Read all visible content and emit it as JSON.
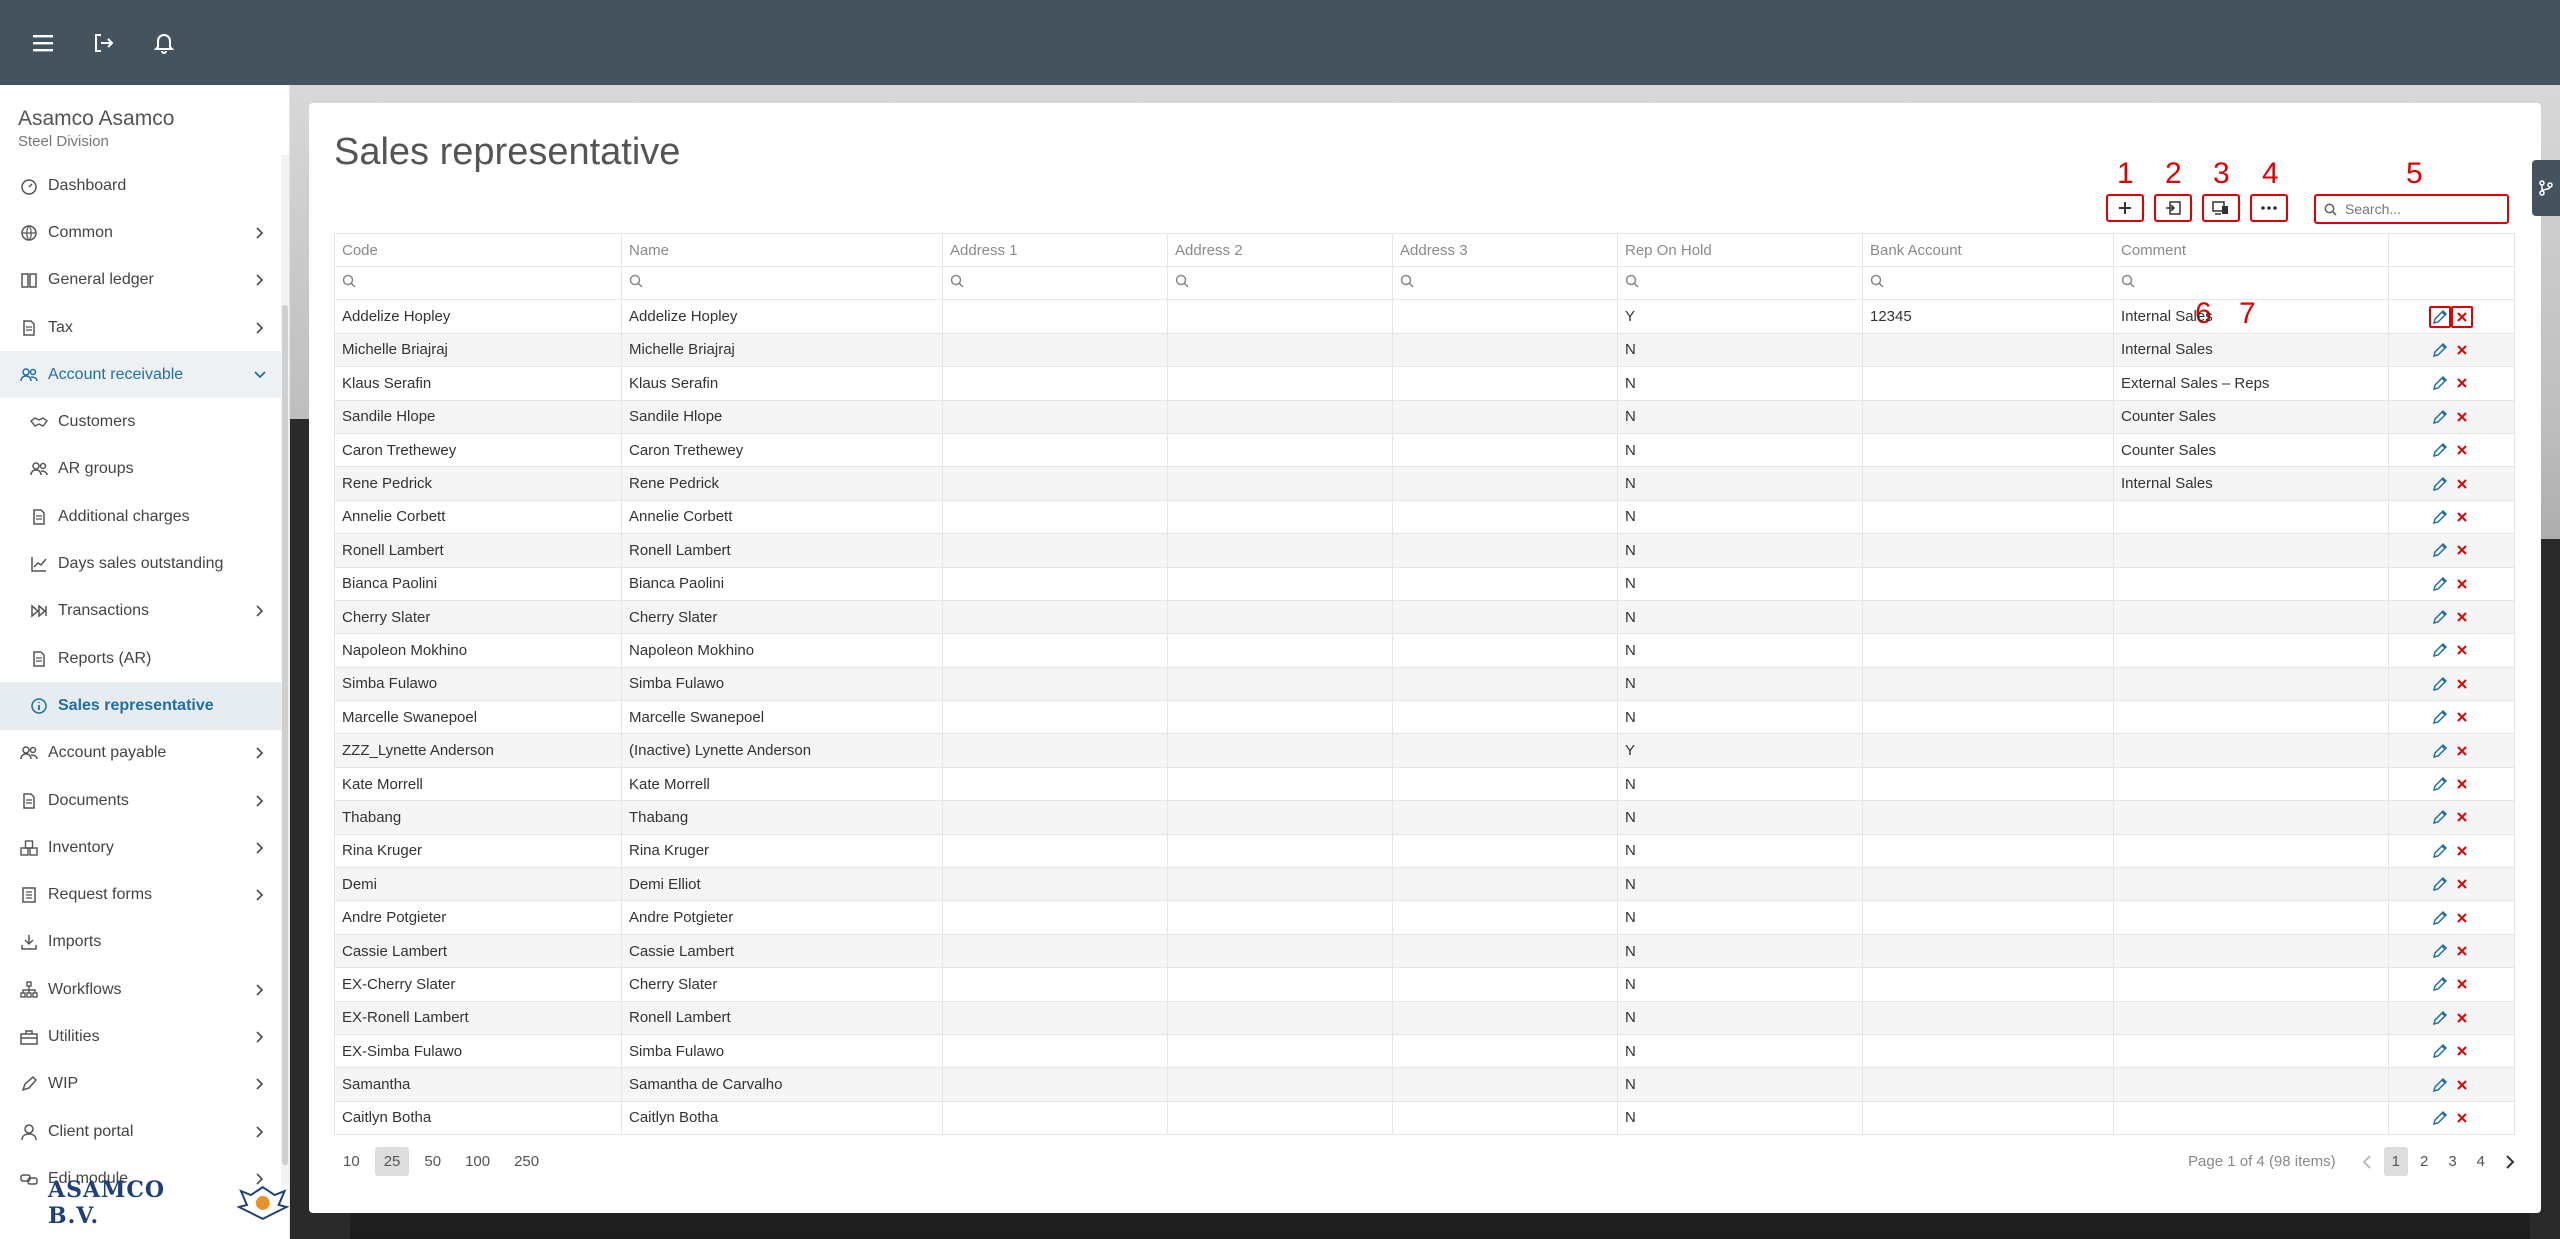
{
  "company": {
    "name": "Asamco Asamco",
    "division": "Steel Division"
  },
  "logo": {
    "text": "ASAMCO B.V."
  },
  "sidebar": {
    "items": [
      {
        "label": "Dashboard",
        "icon": "dashboard-icon",
        "chevron": false,
        "name": "sidebar-item-dashboard"
      },
      {
        "label": "Common",
        "icon": "globe-icon",
        "chevron": true,
        "name": "sidebar-item-common"
      },
      {
        "label": "General ledger",
        "icon": "book-icon",
        "chevron": true,
        "name": "sidebar-item-general-ledger"
      },
      {
        "label": "Tax",
        "icon": "document-icon",
        "chevron": true,
        "name": "sidebar-item-tax"
      },
      {
        "label": "Account receivable",
        "icon": "users-icon",
        "chevron": "down",
        "name": "sidebar-item-account-receivable",
        "state": "open"
      },
      {
        "label": "Customers",
        "icon": "handshake-icon",
        "sub": true,
        "name": "sidebar-item-customers"
      },
      {
        "label": "AR groups",
        "icon": "users-icon",
        "sub": true,
        "name": "sidebar-item-ar-groups"
      },
      {
        "label": "Additional charges",
        "icon": "document-icon",
        "sub": true,
        "name": "sidebar-item-additional-charges"
      },
      {
        "label": "Days sales outstanding",
        "icon": "chart-line-icon",
        "sub": true,
        "name": "sidebar-item-days-sales-outstanding"
      },
      {
        "label": "Transactions",
        "icon": "fast-forward-icon",
        "sub": true,
        "chevron": true,
        "name": "sidebar-item-transactions"
      },
      {
        "label": "Reports (AR)",
        "icon": "document-icon",
        "sub": true,
        "name": "sidebar-item-reports-ar"
      },
      {
        "label": "Sales representative",
        "icon": "info-circle-icon",
        "sub": true,
        "name": "sidebar-item-sales-representative",
        "state": "active"
      },
      {
        "label": "Account payable",
        "icon": "users-icon",
        "chevron": true,
        "name": "sidebar-item-account-payable"
      },
      {
        "label": "Documents",
        "icon": "document-icon",
        "chevron": true,
        "name": "sidebar-item-documents"
      },
      {
        "label": "Inventory",
        "icon": "boxes-icon",
        "chevron": true,
        "name": "sidebar-item-inventory"
      },
      {
        "label": "Request forms",
        "icon": "form-icon",
        "chevron": true,
        "name": "sidebar-item-request-forms"
      },
      {
        "label": "Imports",
        "icon": "import-icon",
        "chevron": false,
        "name": "sidebar-item-imports"
      },
      {
        "label": "Workflows",
        "icon": "sitemap-icon",
        "chevron": true,
        "name": "sidebar-item-workflows"
      },
      {
        "label": "Utilities",
        "icon": "toolbox-icon",
        "chevron": true,
        "name": "sidebar-item-utilities"
      },
      {
        "label": "WIP",
        "icon": "pen-icon",
        "chevron": true,
        "name": "sidebar-item-wip"
      },
      {
        "label": "Client portal",
        "icon": "user-icon",
        "chevron": true,
        "name": "sidebar-item-client-portal"
      },
      {
        "label": "Edi module",
        "icon": "link-icon",
        "chevron": true,
        "name": "sidebar-item-edi-module"
      }
    ]
  },
  "page": {
    "title": "Sales representative"
  },
  "toolbar": {
    "markers": [
      "1",
      "2",
      "3",
      "4",
      "5"
    ],
    "search_placeholder": "Search..."
  },
  "row_markers": {
    "edit": "6",
    "delete": "7"
  },
  "table": {
    "columns": [
      "Code",
      "Name",
      "Address 1",
      "Address 2",
      "Address 3",
      "Rep On Hold",
      "Bank Account",
      "Comment"
    ],
    "rows": [
      [
        "Addelize Hopley",
        "Addelize Hopley",
        "",
        "",
        "",
        "Y",
        "12345",
        "Internal Sales"
      ],
      [
        "Michelle Briajraj",
        "Michelle Briajraj",
        "",
        "",
        "",
        "N",
        "",
        "Internal Sales"
      ],
      [
        "Klaus Serafin",
        "Klaus Serafin",
        "",
        "",
        "",
        "N",
        "",
        "External Sales – Reps"
      ],
      [
        "Sandile Hlope",
        "Sandile Hlope",
        "",
        "",
        "",
        "N",
        "",
        "Counter Sales"
      ],
      [
        "Caron Trethewey",
        "Caron Trethewey",
        "",
        "",
        "",
        "N",
        "",
        "Counter Sales"
      ],
      [
        "Rene Pedrick",
        "Rene Pedrick",
        "",
        "",
        "",
        "N",
        "",
        "Internal Sales"
      ],
      [
        "Annelie Corbett",
        "Annelie Corbett",
        "",
        "",
        "",
        "N",
        "",
        ""
      ],
      [
        "Ronell Lambert",
        "Ronell Lambert",
        "",
        "",
        "",
        "N",
        "",
        ""
      ],
      [
        "Bianca Paolini",
        "Bianca Paolini",
        "",
        "",
        "",
        "N",
        "",
        ""
      ],
      [
        "Cherry Slater",
        "Cherry Slater",
        "",
        "",
        "",
        "N",
        "",
        ""
      ],
      [
        "Napoleon Mokhino",
        "Napoleon Mokhino",
        "",
        "",
        "",
        "N",
        "",
        ""
      ],
      [
        "Simba Fulawo",
        "Simba Fulawo",
        "",
        "",
        "",
        "N",
        "",
        ""
      ],
      [
        "Marcelle Swanepoel",
        "Marcelle Swanepoel",
        "",
        "",
        "",
        "N",
        "",
        ""
      ],
      [
        "ZZZ_Lynette Anderson",
        "(Inactive) Lynette Anderson",
        "",
        "",
        "",
        "Y",
        "",
        ""
      ],
      [
        "Kate Morrell",
        "Kate Morrell",
        "",
        "",
        "",
        "N",
        "",
        ""
      ],
      [
        "Thabang",
        "Thabang",
        "",
        "",
        "",
        "N",
        "",
        ""
      ],
      [
        "Rina Kruger",
        "Rina Kruger",
        "",
        "",
        "",
        "N",
        "",
        ""
      ],
      [
        "Demi",
        "Demi Elliot",
        "",
        "",
        "",
        "N",
        "",
        ""
      ],
      [
        "Andre Potgieter",
        "Andre Potgieter",
        "",
        "",
        "",
        "N",
        "",
        ""
      ],
      [
        "Cassie Lambert",
        "Cassie Lambert",
        "",
        "",
        "",
        "N",
        "",
        ""
      ],
      [
        "EX-Cherry Slater",
        "Cherry Slater",
        "",
        "",
        "",
        "N",
        "",
        ""
      ],
      [
        "EX-Ronell Lambert",
        "Ronell Lambert",
        "",
        "",
        "",
        "N",
        "",
        ""
      ],
      [
        "EX-Simba Fulawo",
        "Simba Fulawo",
        "",
        "",
        "",
        "N",
        "",
        ""
      ],
      [
        "Samantha",
        "Samantha de Carvalho",
        "",
        "",
        "",
        "N",
        "",
        ""
      ],
      [
        "Caitlyn Botha",
        "Caitlyn Botha",
        "",
        "",
        "",
        "N",
        "",
        ""
      ]
    ]
  },
  "pager": {
    "sizes": [
      "10",
      "25",
      "50",
      "100",
      "250"
    ],
    "selected_size": "25",
    "info": "Page 1 of 4 (98 items)",
    "pages": [
      "1",
      "2",
      "3",
      "4"
    ],
    "current_page": "1"
  },
  "colors": {
    "topbar": "#45535e",
    "accent": "#1f6fa5",
    "annotation": "#e00000",
    "delete": "#d01010"
  }
}
